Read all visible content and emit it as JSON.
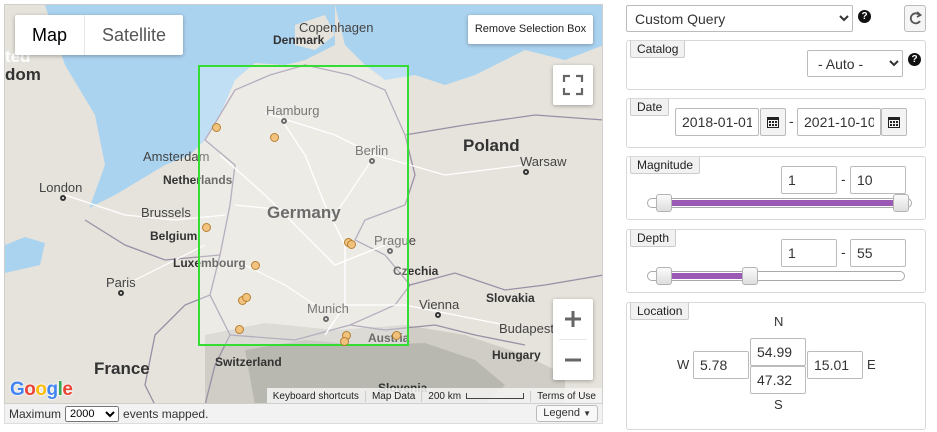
{
  "map": {
    "type_buttons": [
      "Map",
      "Satellite"
    ],
    "remove_selection_label": "Remove Selection Box",
    "zoom_in": "+",
    "zoom_out": "−",
    "google": "Google",
    "attribution": {
      "shortcuts": "Keyboard shortcuts",
      "data": "Map Data",
      "scale": "200 km",
      "terms": "Terms of Use"
    },
    "labels": {
      "germany": "Germany",
      "poland": "Poland",
      "france": "France",
      "denmark": "Denmark",
      "czechia": "Czechia",
      "slovakia": "Slovakia",
      "hungary": "Hungary",
      "switzerland": "Switzerland",
      "slovenia": "Slovenia",
      "austria": "Austria",
      "netherlands": "Netherlands",
      "belgium": "Belgium",
      "luxembourg": "Luxembourg",
      "ted": "ted",
      "dom": "dom",
      "hamburg": "Hamburg",
      "berlin": "Berlin",
      "copenhagen": "Copenhagen",
      "amsterdam": "Amsterdam",
      "london": "London",
      "brussels": "Brussels",
      "paris": "Paris",
      "prague": "Prague",
      "warsaw": "Warsaw",
      "munich": "Munich",
      "vienna": "Vienna",
      "budapest": "Budapest"
    }
  },
  "footer": {
    "prefix": "Maximum",
    "max_events": "2000",
    "suffix": "events mapped.",
    "legend": "Legend"
  },
  "query": {
    "selected": "Custom Query",
    "help": "?"
  },
  "catalog": {
    "label": "Catalog",
    "selected": "- Auto -",
    "help": "?"
  },
  "date": {
    "label": "Date",
    "from": "2018-01-01",
    "to": "2021-10-10",
    "separator": "-"
  },
  "magnitude": {
    "label": "Magnitude",
    "min": "1",
    "max": "10",
    "separator": "-",
    "range_fraction": [
      0.0,
      1.0
    ]
  },
  "depth": {
    "label": "Depth",
    "min": "1",
    "max": "55",
    "separator": "-",
    "range_fraction": [
      0.0,
      0.4
    ]
  },
  "location": {
    "label": "Location",
    "north_label": "N",
    "south_label": "S",
    "west_label": "W",
    "east_label": "E",
    "north": "54.99",
    "south": "47.32",
    "west": "5.78",
    "east": "15.01"
  },
  "colors": {
    "selection_border": "#33dd33",
    "slider_range": "#9b59b6",
    "water": "#aad3f0",
    "land": "#e6e3dc",
    "event_fill": "#f3c27a"
  }
}
